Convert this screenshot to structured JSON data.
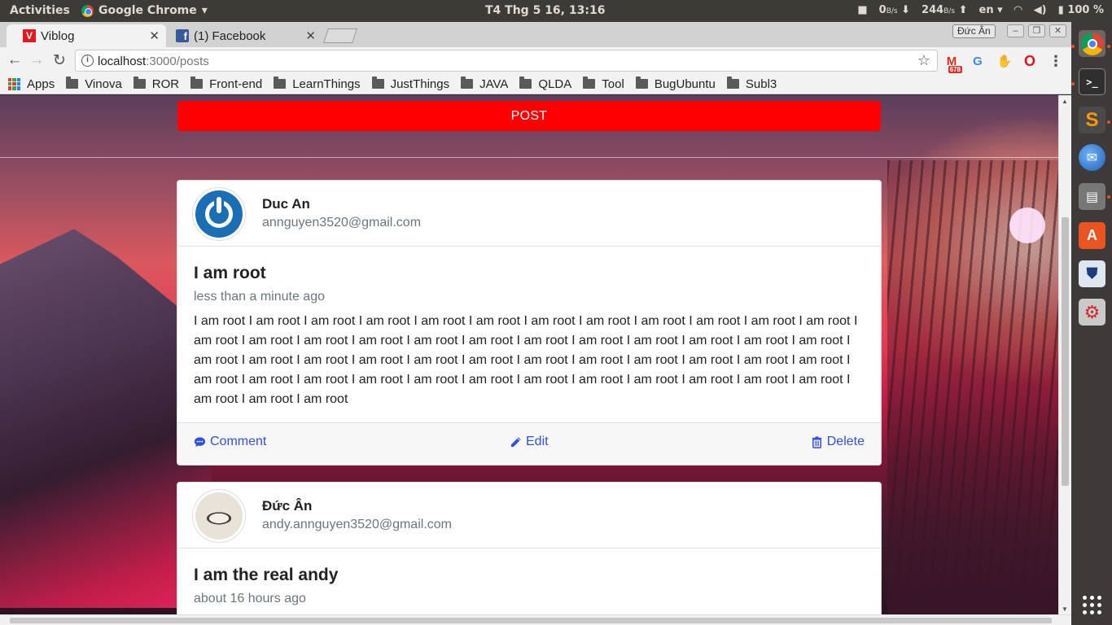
{
  "system": {
    "activities": "Activities",
    "app_name": "Google Chrome",
    "clock": "T4 Thg 5 16, 13:16",
    "net_down_value": "0",
    "net_down_unit": "B/s",
    "net_up_value": "244",
    "net_up_unit": "B/s",
    "lang": "en",
    "battery": "100 %"
  },
  "browser": {
    "tabs": [
      {
        "title": "Viblog",
        "active": true
      },
      {
        "title": "(1) Facebook",
        "active": false
      }
    ],
    "profile_name": "Đức Ân",
    "url_host": "localhost",
    "url_path": ":3000/posts",
    "extensions": [
      {
        "icon": "gmail-icon",
        "badge": "678"
      },
      {
        "icon": "google-translate-icon"
      },
      {
        "icon": "gnome-extensions-icon"
      },
      {
        "icon": "opera-icon"
      }
    ],
    "bookmarks": [
      "Apps",
      "Vinova",
      "ROR",
      "Front-end",
      "LearnThings",
      "JustThings",
      "JAVA",
      "QLDA",
      "Tool",
      "BugUbuntu",
      "Subl3"
    ]
  },
  "page": {
    "post_button": "POST",
    "posts": [
      {
        "author": "Duc An",
        "email": "annguyen3520@gmail.com",
        "title": "I am root",
        "time": "less than a minute ago",
        "body": "I am root I am root I am root I am root I am root I am root I am root I am root I am root I am root I am root I am root I am root I am root I am root I am root I am root I am root I am root I am root I am root I am root I am root I am root I am root I am root I am root I am root I am root I am root I am root I am root I am root I am root I am root I am root I am root I am root I am root I am root I am root I am root I am root I am root I am root I am root I am root I am root I am root I am root I am root",
        "actions": {
          "comment": "Comment",
          "edit": "Edit",
          "delete": "Delete"
        }
      },
      {
        "author": "Đức Ân",
        "email": "andy.annguyen3520@gmail.com",
        "title": "I am the real andy",
        "time": "about 16 hours ago"
      }
    ]
  },
  "colors": {
    "post_button": "#ff0000",
    "action_link": "#3050e0",
    "muted_text": "#6c757d",
    "ubuntu_bar": "#3c3b37"
  }
}
